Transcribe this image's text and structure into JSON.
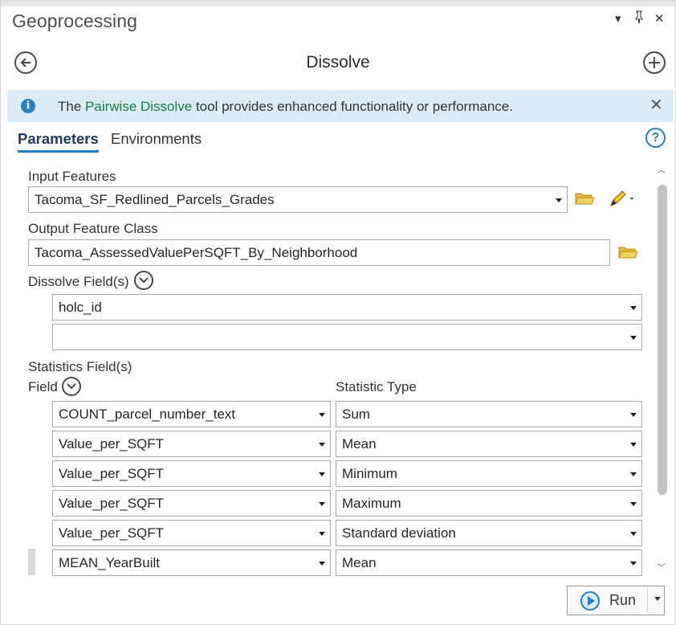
{
  "pane": {
    "title": "Geoprocessing",
    "controls": {
      "menu": "▾",
      "pin": "⊣",
      "close": "✕"
    }
  },
  "header": {
    "tool_title": "Dissolve",
    "back_icon": "back-arrow-icon",
    "add_icon": "plus-icon"
  },
  "banner": {
    "prefix": "The ",
    "link": "Pairwise Dissolve",
    "suffix": " tool provides enhanced functionality or performance.",
    "info_glyph": "i",
    "close_glyph": "✕"
  },
  "tabs": [
    {
      "label": "Parameters",
      "active": true
    },
    {
      "label": "Environments",
      "active": false
    }
  ],
  "help_glyph": "?",
  "params": {
    "input_features_label": "Input Features",
    "input_features_value": "Tacoma_SF_Redlined_Parcels_Grades",
    "output_label": "Output Feature Class",
    "output_value": "Tacoma_AssessedValuePerSQFT_By_Neighborhood",
    "dissolve_label": "Dissolve Field(s)",
    "dissolve_fields": [
      "holc_id",
      ""
    ],
    "statistics_label": "Statistics Field(s)",
    "field_col_label": "Field",
    "stat_col_label": "Statistic Type",
    "stats_rows": [
      {
        "field": "COUNT_parcel_number_text",
        "stat": "Sum"
      },
      {
        "field": "Value_per_SQFT",
        "stat": "Mean"
      },
      {
        "field": "Value_per_SQFT",
        "stat": "Minimum"
      },
      {
        "field": "Value_per_SQFT",
        "stat": "Maximum"
      },
      {
        "field": "Value_per_SQFT",
        "stat": "Standard deviation"
      },
      {
        "field": "MEAN_YearBuilt",
        "stat": "Mean"
      }
    ]
  },
  "run": {
    "label": "Run"
  },
  "colors": {
    "accent": "#1e7fc6",
    "banner_bg": "#dcedf9",
    "link_green": "#1a7a3c",
    "folder_yellow": "#e8b93a"
  }
}
